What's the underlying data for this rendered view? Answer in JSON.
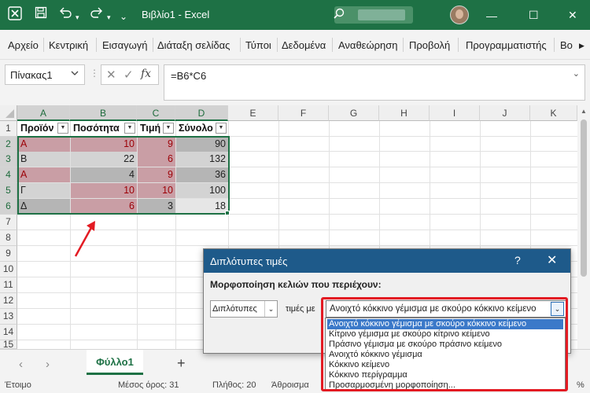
{
  "titlebar": {
    "title": "Βιβλίο1 - Excel",
    "minimize": "—",
    "maximize": "☐",
    "close": "✕",
    "colors": {
      "bar": "#1e7145"
    }
  },
  "ribbon": {
    "tabs": [
      "Αρχείο",
      "Κεντρική",
      "Εισαγωγή",
      "Διάταξη σελίδας",
      "Τύποι",
      "Δεδομένα",
      "Αναθεώρηση",
      "Προβολή",
      "Προγραμματιστής",
      "Βο"
    ],
    "more": "▶"
  },
  "formula_bar": {
    "name_box": "Πίνακας1",
    "fx": "fx",
    "formula": "=B6*C6"
  },
  "grid": {
    "columns": [
      "A",
      "B",
      "C",
      "D",
      "E",
      "F",
      "G",
      "H",
      "I",
      "J",
      "K"
    ],
    "rows": [
      "1",
      "2",
      "3",
      "4",
      "5",
      "6",
      "7",
      "8",
      "9",
      "10",
      "11",
      "12",
      "13",
      "14",
      "15"
    ],
    "headers": [
      "Προϊόν",
      "Ποσότητα",
      "Τιμή",
      "Σύνολο"
    ],
    "data": [
      [
        "A",
        "10",
        "9",
        "90"
      ],
      [
        "B",
        "22",
        "6",
        "132"
      ],
      [
        "A",
        "4",
        "9",
        "36"
      ],
      [
        "Γ",
        "10",
        "10",
        "100"
      ],
      [
        "Δ",
        "6",
        "3",
        "18"
      ]
    ],
    "colors": {
      "duplicate_fill": "#c99ea5",
      "duplicate_text": "#9c0006",
      "band_light": "#d3d3d3",
      "band_dark": "#b5b5b5"
    }
  },
  "sheets": {
    "tabs": [
      "Φύλλο1"
    ],
    "add": "+",
    "prev": "‹",
    "next": "›"
  },
  "status": {
    "ready": "Έτοιμο",
    "average": "Μέσος όρος: 31",
    "count": "Πλήθος: 20",
    "sum": "Άθροισμα",
    "zoom": "%"
  },
  "dialog": {
    "title": "Διπλότυπες τιμές",
    "help": "?",
    "close": "✕",
    "label": "Μορφοποίηση κελιών που περιέχουν:",
    "type_value": "Διπλότυπες",
    "middle_label": "τιμές με",
    "format_value": "Ανοιχτό κόκκινο γέμισμα με σκούρο κόκκινο κείμενο",
    "options": [
      "Ανοιχτό κόκκινο γέμισμα με σκούρο κόκκινο κείμενο",
      "Κίτρινο γέμισμα με σκούρο κίτρινο κείμενο",
      "Πράσινο γέμισμα με σκούρο πράσινο κείμενο",
      "Ανοιχτό κόκκινο γέμισμα",
      "Κόκκινο κείμενο",
      "Κόκκινο περίγραμμα",
      "Προσαρμοσμένη μορφοποίηση..."
    ],
    "selected_option": 0
  },
  "annotations": {
    "highlight_color": "#e31b23"
  }
}
